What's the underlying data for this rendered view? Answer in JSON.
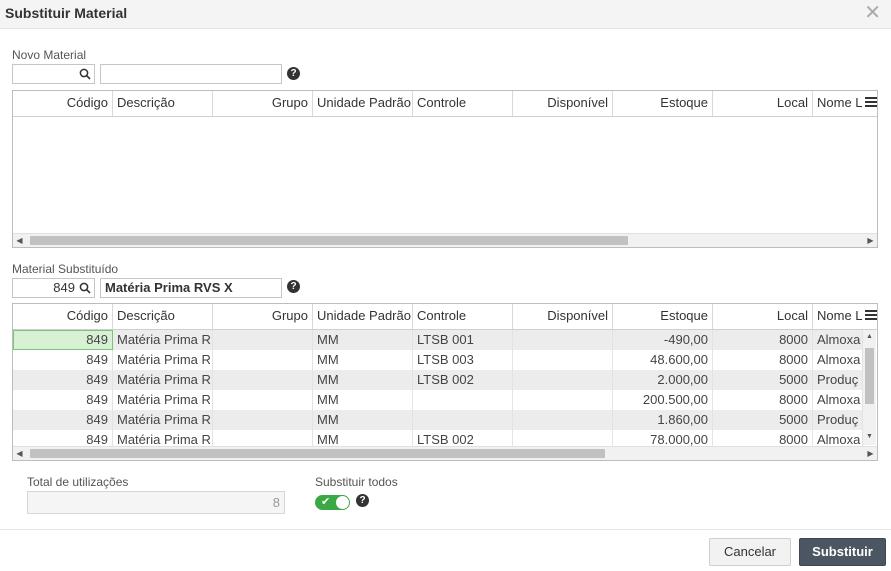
{
  "dialog": {
    "title": "Substituir Material",
    "close_glyph": "✕"
  },
  "novo_material": {
    "label": "Novo Material",
    "code_value": "",
    "description_value": "",
    "help_glyph": "?",
    "columns": [
      "Código",
      "Descrição",
      "Grupo",
      "Unidade Padrão",
      "Controle",
      "Disponível",
      "Estoque",
      "Local",
      "Nome L"
    ],
    "rows": []
  },
  "material_substituido": {
    "label": "Material Substituído",
    "code_value": "849",
    "description_value": "Matéria Prima RVS X",
    "help_glyph": "?",
    "columns": [
      "Código",
      "Descrição",
      "Grupo",
      "Unidade Padrão",
      "Controle",
      "Disponível",
      "Estoque",
      "Local",
      "Nome L"
    ],
    "rows": [
      {
        "codigo": "849",
        "descricao": "Matéria Prima R",
        "grupo": "",
        "unidade": "MM",
        "controle": "LTSB 001",
        "disponivel": "",
        "estoque": "-490,00",
        "local": "8000",
        "nome": "Almoxa"
      },
      {
        "codigo": "849",
        "descricao": "Matéria Prima R",
        "grupo": "",
        "unidade": "MM",
        "controle": "LTSB 003",
        "disponivel": "",
        "estoque": "48.600,00",
        "local": "8000",
        "nome": "Almoxa"
      },
      {
        "codigo": "849",
        "descricao": "Matéria Prima R",
        "grupo": "",
        "unidade": "MM",
        "controle": "LTSB 002",
        "disponivel": "",
        "estoque": "2.000,00",
        "local": "5000",
        "nome": "Produç"
      },
      {
        "codigo": "849",
        "descricao": "Matéria Prima R",
        "grupo": "",
        "unidade": "MM",
        "controle": "",
        "disponivel": "",
        "estoque": "200.500,00",
        "local": "8000",
        "nome": "Almoxa"
      },
      {
        "codigo": "849",
        "descricao": "Matéria Prima R",
        "grupo": "",
        "unidade": "MM",
        "controle": "",
        "disponivel": "",
        "estoque": "1.860,00",
        "local": "5000",
        "nome": "Produç"
      },
      {
        "codigo": "849",
        "descricao": "Matéria Prima R",
        "grupo": "",
        "unidade": "MM",
        "controle": "LTSB 002",
        "disponivel": "",
        "estoque": "78.000,00",
        "local": "8000",
        "nome": "Almoxa"
      }
    ]
  },
  "total_utilizacoes": {
    "label": "Total de utilizações",
    "value": "8"
  },
  "substituir_todos": {
    "label": "Substituir todos",
    "checked": true,
    "help_glyph": "?"
  },
  "buttons": {
    "cancel_label": "Cancelar",
    "submit_label": "Substituir"
  },
  "icons": {
    "search": "search-icon",
    "help": "help-icon",
    "column_menu": "menu-icon"
  },
  "colors": {
    "primary_button": "#4c5562",
    "toggle_on": "#3aa845",
    "selected_cell": "#d8f0d4"
  }
}
